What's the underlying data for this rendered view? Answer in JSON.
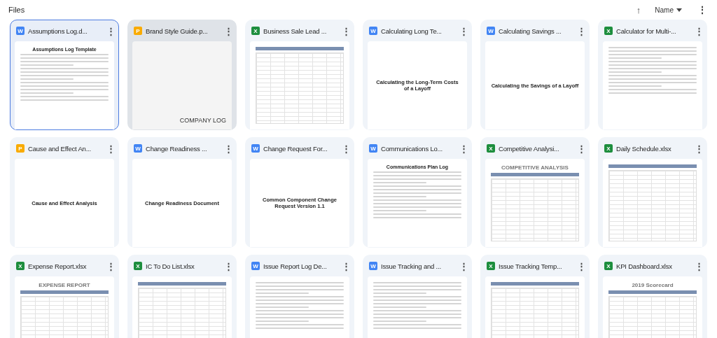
{
  "header": {
    "title": "Files",
    "sort_icon": "↑",
    "sort_label": "Name",
    "more": "⋮"
  },
  "files": [
    {
      "name": "Assumptions Log.d...",
      "kind": "doc",
      "badge": "W",
      "selected": true,
      "hovered": false,
      "preview": {
        "kind": "doc",
        "heading": "Assumptions Log Template"
      }
    },
    {
      "name": "Brand Style Guide.p...",
      "kind": "slides",
      "badge": "P",
      "selected": false,
      "hovered": true,
      "preview": {
        "kind": "slide",
        "heading": "COMPANY LOG"
      }
    },
    {
      "name": "Business Sale Lead ...",
      "kind": "sheet",
      "badge": "X",
      "selected": false,
      "hovered": false,
      "preview": {
        "kind": "sheet"
      }
    },
    {
      "name": "Calculating Long Te...",
      "kind": "doc",
      "badge": "W",
      "selected": false,
      "hovered": false,
      "preview": {
        "kind": "title",
        "heading": "Calculating the Long-Term Costs of a Layoff"
      }
    },
    {
      "name": "Calculating Savings ...",
      "kind": "doc",
      "badge": "W",
      "selected": false,
      "hovered": false,
      "preview": {
        "kind": "title",
        "heading": "Calculating the Savings of a Layoff"
      }
    },
    {
      "name": "Calculator for Multi-...",
      "kind": "sheet",
      "badge": "X",
      "selected": false,
      "hovered": false,
      "preview": {
        "kind": "doc"
      }
    },
    {
      "name": "Cause and Effect An...",
      "kind": "slides",
      "badge": "P",
      "selected": false,
      "hovered": false,
      "preview": {
        "kind": "title",
        "heading": "Cause and Effect Analysis"
      }
    },
    {
      "name": "Change Readiness ...",
      "kind": "doc",
      "badge": "W",
      "selected": false,
      "hovered": false,
      "preview": {
        "kind": "title",
        "heading": "Change Readiness Document"
      }
    },
    {
      "name": "Change Request For...",
      "kind": "doc",
      "badge": "W",
      "selected": false,
      "hovered": false,
      "preview": {
        "kind": "title",
        "heading": "Common Component Change Request Version 1.1"
      }
    },
    {
      "name": "Communications Lo...",
      "kind": "doc",
      "badge": "W",
      "selected": false,
      "hovered": false,
      "preview": {
        "kind": "doc",
        "heading": "Communications Plan Log"
      }
    },
    {
      "name": "Competitive Analysi...",
      "kind": "sheet",
      "badge": "X",
      "selected": false,
      "hovered": false,
      "preview": {
        "kind": "sheet",
        "heading": "COMPETITIVE ANALYSIS"
      }
    },
    {
      "name": "Daily Schedule.xlsx",
      "kind": "sheet",
      "badge": "X",
      "selected": false,
      "hovered": false,
      "preview": {
        "kind": "sheet"
      }
    },
    {
      "name": "Expense Report.xlsx",
      "kind": "sheet",
      "badge": "X",
      "selected": false,
      "hovered": false,
      "preview": {
        "kind": "sheet",
        "heading": "EXPENSE REPORT"
      }
    },
    {
      "name": "IC To Do List.xlsx",
      "kind": "sheet",
      "badge": "X",
      "selected": false,
      "hovered": false,
      "preview": {
        "kind": "sheet"
      }
    },
    {
      "name": "Issue Report Log De...",
      "kind": "doc",
      "badge": "W",
      "selected": false,
      "hovered": false,
      "preview": {
        "kind": "doc"
      }
    },
    {
      "name": "Issue Tracking and ...",
      "kind": "doc",
      "badge": "W",
      "selected": false,
      "hovered": false,
      "preview": {
        "kind": "doc"
      }
    },
    {
      "name": "Issue Tracking Temp...",
      "kind": "sheet",
      "badge": "X",
      "selected": false,
      "hovered": false,
      "preview": {
        "kind": "sheet"
      }
    },
    {
      "name": "KPI Dashboard.xlsx",
      "kind": "sheet",
      "badge": "X",
      "selected": false,
      "hovered": false,
      "preview": {
        "kind": "sheet",
        "heading": "2019 Scorecard"
      }
    }
  ]
}
